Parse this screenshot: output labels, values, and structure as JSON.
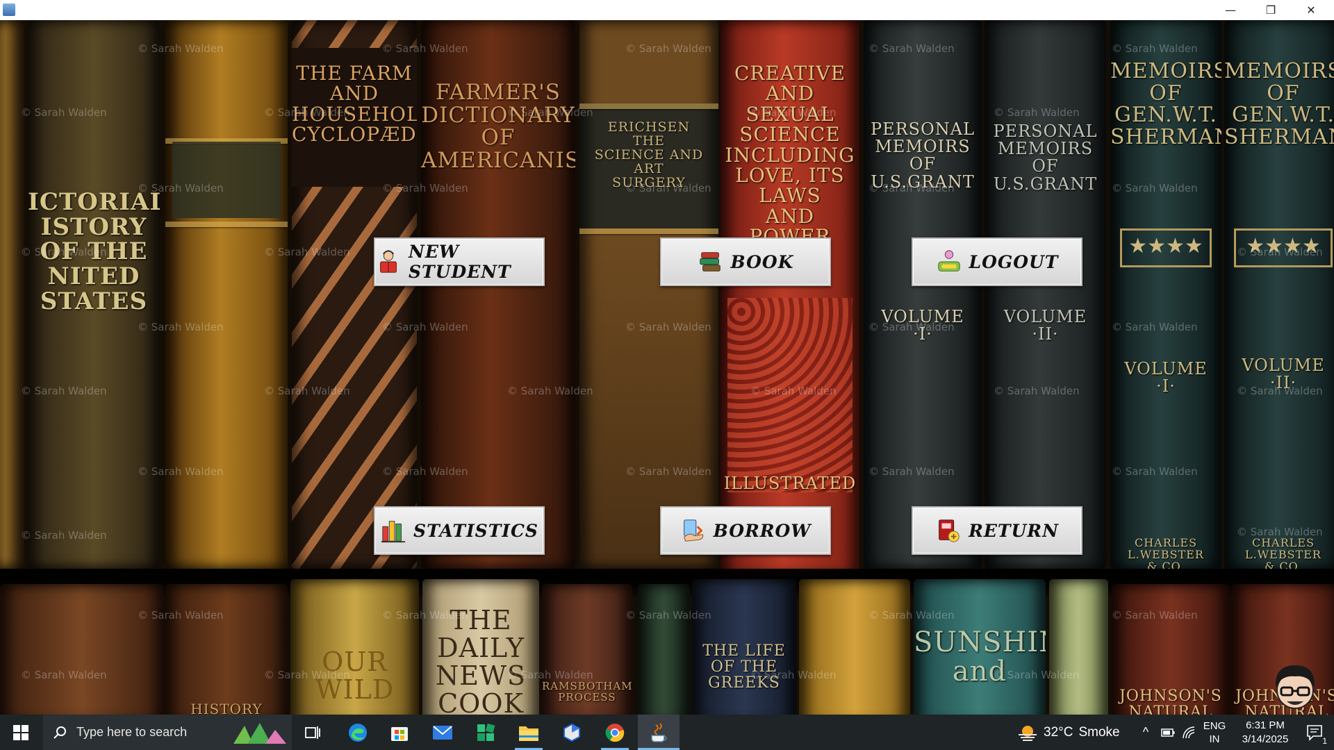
{
  "window": {
    "minimize_glyph": "—",
    "restore_glyph": "❐",
    "close_glyph": "✕"
  },
  "background": {
    "watermark": "© Sarah Walden",
    "spines": {
      "pictorial": "ICTORIAL\nISTORY\nOF THE\nNITED STATES",
      "farm": "THE FARM\nAND\nHOUSEHOLD\nCYCLOPÆDIA",
      "farmers": "FARMER'S\nDICTIONARY\nOF\nAMERICANISMS",
      "erichsen": "ERICHSEN\nTHE\nSCIENCE AND ART\nSURGERY",
      "creative": "CREATIVE\nAND\nSEXUAL SCIENCE\nINCLUDING\nLOVE, ITS LAWS\nAND\nPOWER",
      "illustrated": "ILLUSTRATED",
      "grant1": "PERSONAL\nMEMOIRS\nOF\nU.S.GRANT",
      "grant1_vol": "VOLUME\n·I·",
      "grant2": "PERSONAL\nMEMOIRS\nOF\nU.S.GRANT",
      "grant2_vol": "VOLUME\n·II·",
      "sherman1": "MEMOIRS\nOF\nGEN.W.T.\nSHERMAN",
      "sherman1_vol": "VOLUME\n·I·",
      "sherman2": "MEMOIRS\nOF\nGEN.W.T.\nSHERMAN",
      "sherman2_vol": "VOLUME\n·II·",
      "webster": "CHARLES L.WEBSTER\n& CO.",
      "ourwild": "OUR\nWILD",
      "dailynews": "THE\nDAILY\nNEWS\nCOOK",
      "ramsbotham": "RAMSBOTHAM'S\nPROCESS",
      "greeks": "THE LIFE\nOF THE\nGREEKS",
      "sunshine": "SUNSHINE\nand",
      "johnson": "JOHNSON'S\nNATURAL",
      "history": "HISTORY"
    }
  },
  "menu": {
    "new_student": "NEW STUDENT",
    "book": "BOOK",
    "logout": "LOGOUT",
    "statistics": "STATISTICS",
    "borrow": "BORROW",
    "return": "RETURN"
  },
  "taskbar": {
    "search_placeholder": "Type here to search",
    "weather_temp": "32°C",
    "weather_desc": "Smoke",
    "lang_line1": "ENG",
    "lang_line2": "IN",
    "time": "6:31 PM",
    "date": "3/14/2025",
    "notification_count": "1",
    "chevron_glyph": "^"
  },
  "colors": {
    "taskbar_bg": "#1f2427",
    "button_face": "#e4e4e4",
    "accent_indicator": "#76b9ed"
  }
}
